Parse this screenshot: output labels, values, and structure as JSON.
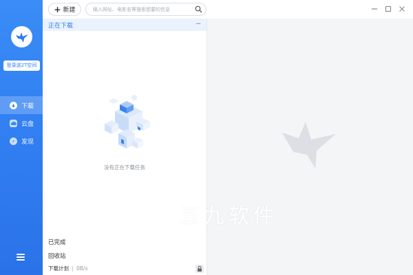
{
  "app": {
    "accent_color": "#2f7cf0",
    "rail_color": "#3a8cf6"
  },
  "sidebar": {
    "logo_icon": "bird-logo-icon",
    "login_label": "登录送2T空间",
    "items": [
      {
        "label": "下载",
        "icon": "download-icon",
        "active": true
      },
      {
        "label": "云盘",
        "icon": "cloud-icon",
        "active": false
      },
      {
        "label": "发现",
        "icon": "compass-icon",
        "active": false
      }
    ],
    "menu_icon": "hamburger-menu-icon"
  },
  "toolbar": {
    "new_label": "新建",
    "search_placeholder": "输入网址、电影名等搜索想要的信息",
    "window_controls": [
      "minimize-icon",
      "maximize-icon",
      "close-icon"
    ]
  },
  "list": {
    "downloading_label": "正在下载",
    "more_label": "···",
    "empty_text": "没有正在下载任务",
    "completed_label": "已完成",
    "trash_label": "回收站",
    "plan_label": "下载计划",
    "speed": "0B/s"
  },
  "overlay": {
    "watermark_text": "五九软件"
  }
}
